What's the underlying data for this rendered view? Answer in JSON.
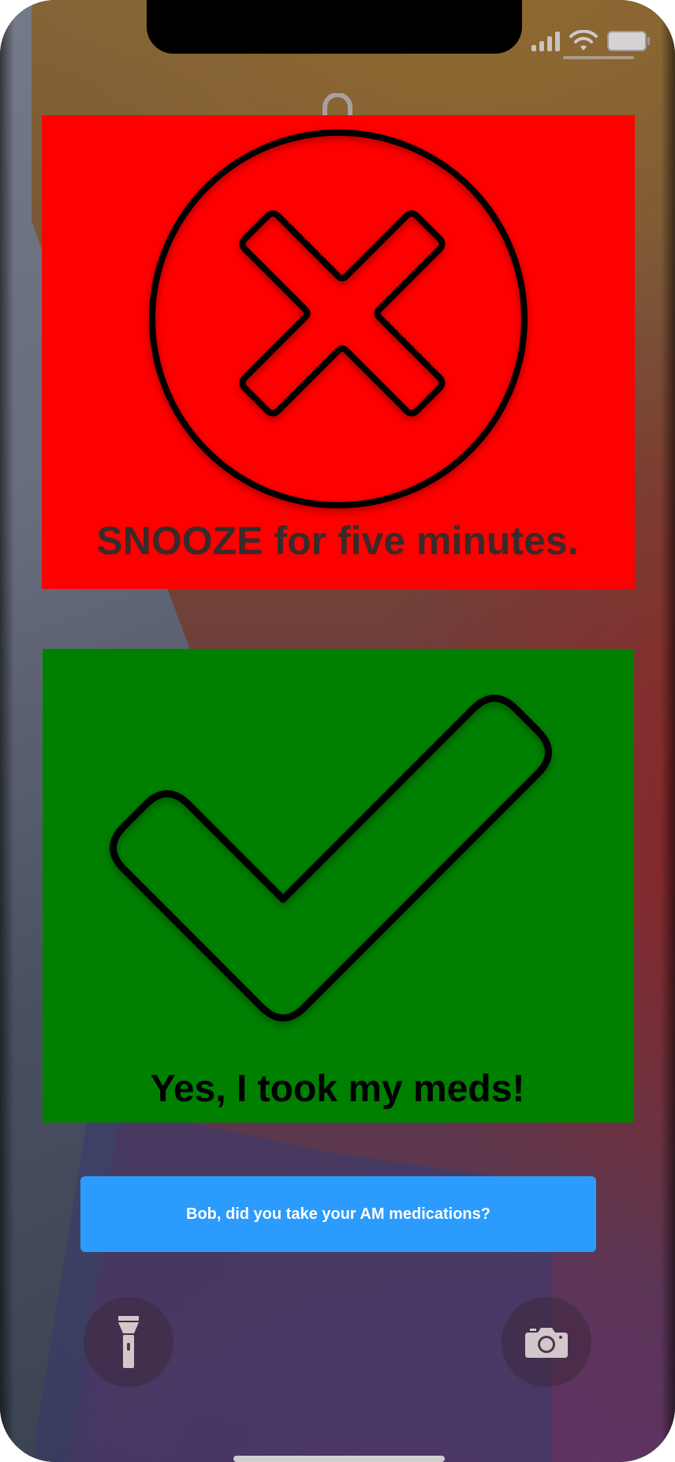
{
  "snooze_button": {
    "label": "SNOOZE for five minutes.",
    "icon": "x-circle-icon",
    "color": "#ff0000"
  },
  "taken_button": {
    "label": "Yes, I took my meds!",
    "icon": "checkmark-icon",
    "color": "#008000"
  },
  "notification": {
    "text": "Bob, did you take your AM medications?",
    "color": "#2b9bfd"
  },
  "lockscreen": {
    "flashlight_icon": "flashlight-icon",
    "camera_icon": "camera-icon",
    "lock_icon": "lock-icon"
  },
  "status_bar": {
    "signal_icon": "cellular-signal-icon",
    "wifi_icon": "wifi-icon",
    "battery_icon": "battery-icon"
  }
}
